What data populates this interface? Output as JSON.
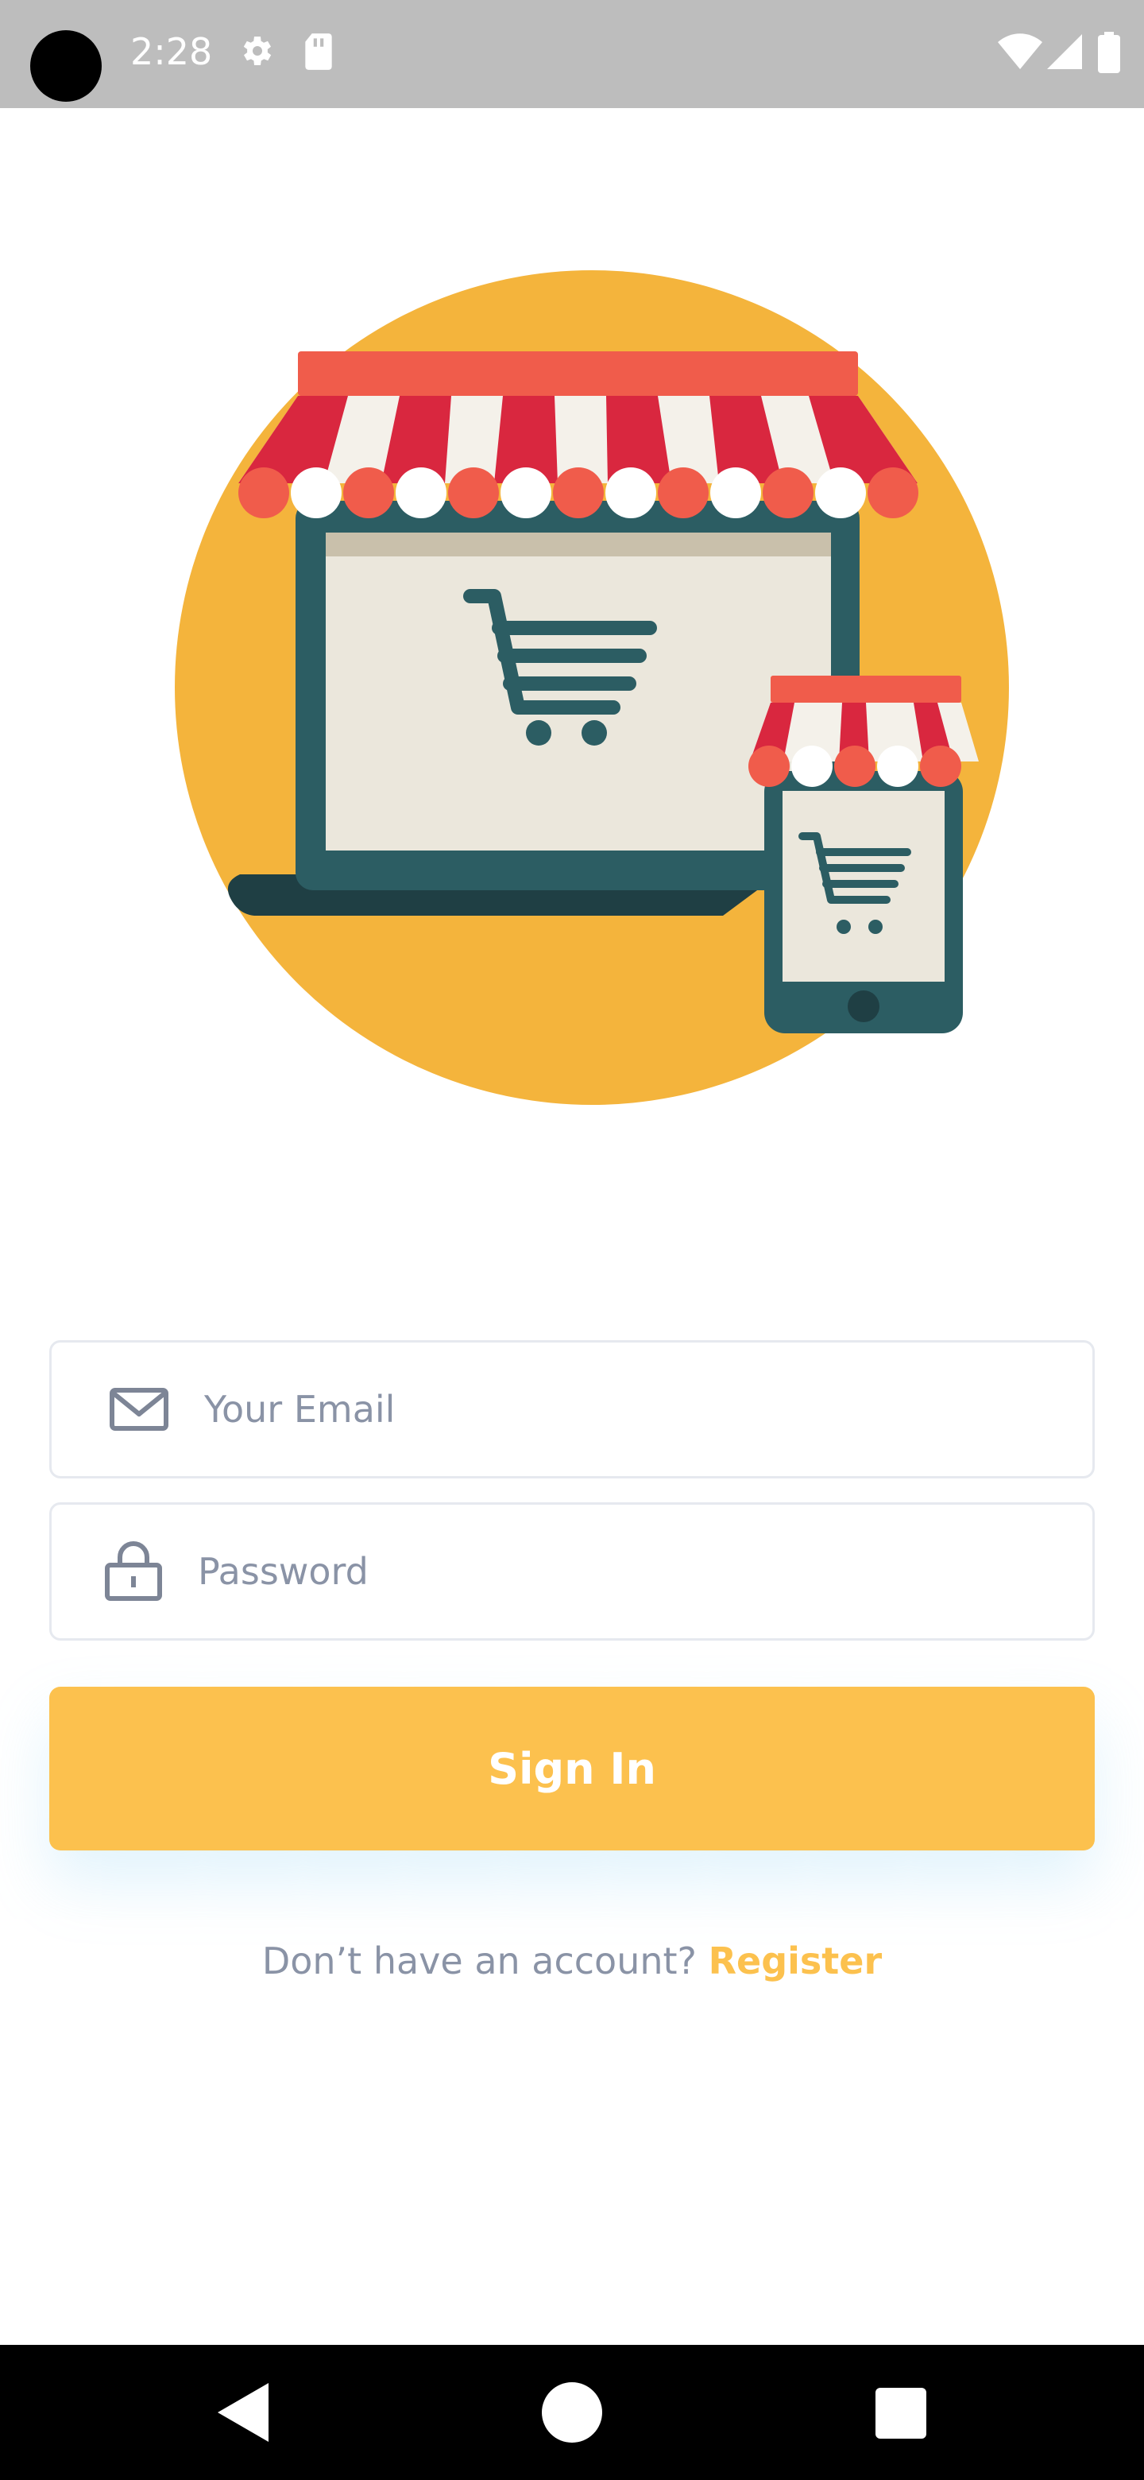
{
  "status_bar": {
    "time": "2:28",
    "icons": [
      "gear-icon",
      "sd-card-icon",
      "wifi-icon",
      "signal-icon",
      "battery-icon"
    ]
  },
  "illustration": {
    "description_icon": "online-shop-illustration-icon",
    "colors": {
      "circle": "#f4b43c",
      "awning_red": "#d9273f",
      "awning_coral": "#f05c4b",
      "device_dark": "#2c5d63",
      "screen": "#ebe7dc"
    }
  },
  "form": {
    "email": {
      "placeholder": "Your Email",
      "value": ""
    },
    "password": {
      "placeholder": "Password",
      "value": ""
    },
    "sign_in_label": "Sign In"
  },
  "footer": {
    "prompt": "Don’t have an account?",
    "register_label": "Register"
  },
  "colors": {
    "accent": "#fcc14e",
    "muted_text": "#8a93a6",
    "field_border": "#e6e9ef"
  },
  "nav_bar": {
    "buttons": [
      "back-icon",
      "home-icon",
      "recents-icon"
    ]
  }
}
